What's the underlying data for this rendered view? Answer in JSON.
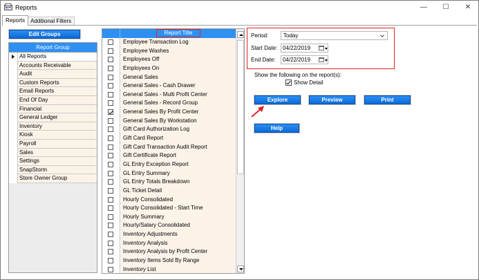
{
  "window": {
    "title": "Reports",
    "controls": {
      "minimize": "—",
      "maximize": "☐",
      "close": "✕"
    }
  },
  "tabs": [
    {
      "label": "Reports",
      "active": true
    },
    {
      "label": "Additional Filters",
      "active": false
    }
  ],
  "edit_groups_label": "Edit Groups",
  "report_group": {
    "header": "Report Group",
    "items": [
      "All Reports",
      "Accounts Receivable",
      "Audit",
      "Custom Reports",
      "Email Reports",
      "End Of Day",
      "Financial",
      "General Ledger",
      "Inventory",
      "Kiosk",
      "Payroll",
      "Sales",
      "Settings",
      "SnapStorm",
      "Store Owner Group"
    ],
    "selected_index": 0
  },
  "report_titles": {
    "header": "Report Title",
    "rows": [
      {
        "name": "Employee Transaction Log",
        "checked": false
      },
      {
        "name": "Employee Washes",
        "checked": false
      },
      {
        "name": "Employees Off",
        "checked": false
      },
      {
        "name": "Employees On",
        "checked": false
      },
      {
        "name": "General Sales",
        "checked": false
      },
      {
        "name": "General Sales - Cash Drawer",
        "checked": false
      },
      {
        "name": "General Sales - Multi Profit Center",
        "checked": false
      },
      {
        "name": "General Sales - Record Group",
        "checked": false
      },
      {
        "name": "General Sales By Profit Center",
        "checked": true
      },
      {
        "name": "General Sales By Workstation",
        "checked": false
      },
      {
        "name": "Gift Card Authorization Log",
        "checked": false
      },
      {
        "name": "Gift Card Report",
        "checked": false
      },
      {
        "name": "Gift Card Transaction Audit Report",
        "checked": false
      },
      {
        "name": "Gift Certificate Report",
        "checked": false
      },
      {
        "name": "GL Entry Exception Report",
        "checked": false
      },
      {
        "name": "GL Entry Summary",
        "checked": false
      },
      {
        "name": "GL Entry Totals Breakdown",
        "checked": false
      },
      {
        "name": "GL Ticket Detail",
        "checked": false
      },
      {
        "name": "Hourly Consolidated",
        "checked": false
      },
      {
        "name": "Hourly Consolidated - Start Time",
        "checked": false
      },
      {
        "name": "Hourly Summary",
        "checked": false
      },
      {
        "name": "Hourly/Salary Consolidated",
        "checked": false
      },
      {
        "name": "Inventory Adjustments",
        "checked": false
      },
      {
        "name": "Inventory Analysis",
        "checked": false
      },
      {
        "name": "Inventory Analysis by Profit Center",
        "checked": false
      },
      {
        "name": "Inventory Items Sold By Range",
        "checked": false
      },
      {
        "name": "Inventory List",
        "checked": false
      }
    ]
  },
  "filters": {
    "period_label": "Period:",
    "period_value": "Today",
    "start_label": "Start Date:",
    "start_value": "04/22/2019",
    "end_label": "End Date:",
    "end_value": "04/22/2019"
  },
  "show_following_label": "Show the following on the report(s):",
  "show_detail": {
    "label": "Show Detail",
    "checked": true
  },
  "buttons": {
    "explore": "Explore",
    "preview": "Preview",
    "print": "Print",
    "help": "Help"
  },
  "colors": {
    "header_blue": "#2e90f2",
    "button_blue": "#1a7de8",
    "highlight_red": "#e02020",
    "row_tint": "#fbf3e8"
  }
}
